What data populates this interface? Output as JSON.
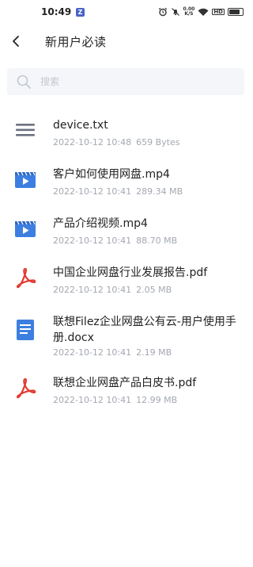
{
  "status_bar": {
    "time": "10:49",
    "app_badge": "Z",
    "net_speed_value": "0.00",
    "net_speed_unit": "K/S",
    "battery_label": "HD",
    "battery_level": 0.8,
    "icons": [
      "alarm-icon",
      "mute-icon",
      "wifi-icon",
      "battery-icon"
    ]
  },
  "header": {
    "back_icon": "chevron-left-icon",
    "title": "新用户必读"
  },
  "search": {
    "placeholder": "搜索",
    "icon": "search-icon"
  },
  "files": [
    {
      "name": "device.txt",
      "date": "2022-10-12 10:48",
      "size": "659 Bytes",
      "type": "txt",
      "icon": "text-file-icon"
    },
    {
      "name": "客户如何使用网盘.mp4",
      "date": "2022-10-12 10:41",
      "size": "289.34 MB",
      "type": "video",
      "icon": "video-file-icon"
    },
    {
      "name": "产品介绍视频.mp4",
      "date": "2022-10-12 10:41",
      "size": "88.70 MB",
      "type": "video",
      "icon": "video-file-icon"
    },
    {
      "name": "中国企业网盘行业发展报告.pdf",
      "date": "2022-10-12 10:41",
      "size": "2.05 MB",
      "type": "pdf",
      "icon": "pdf-file-icon"
    },
    {
      "name": "联想Filez企业网盘公有云-用户使用手册.docx",
      "date": "2022-10-12 10:41",
      "size": "2.19 MB",
      "type": "doc",
      "icon": "document-file-icon"
    },
    {
      "name": "联想企业网盘产品白皮书.pdf",
      "date": "2022-10-12 10:41",
      "size": "12.99 MB",
      "type": "pdf",
      "icon": "pdf-file-icon"
    }
  ],
  "colors": {
    "accent_blue": "#3d7fe0",
    "pdf_red": "#e23b32",
    "text_icon_gray": "#6b7280",
    "meta_gray": "#a3a8b0",
    "search_bg": "#f4f6f9"
  }
}
